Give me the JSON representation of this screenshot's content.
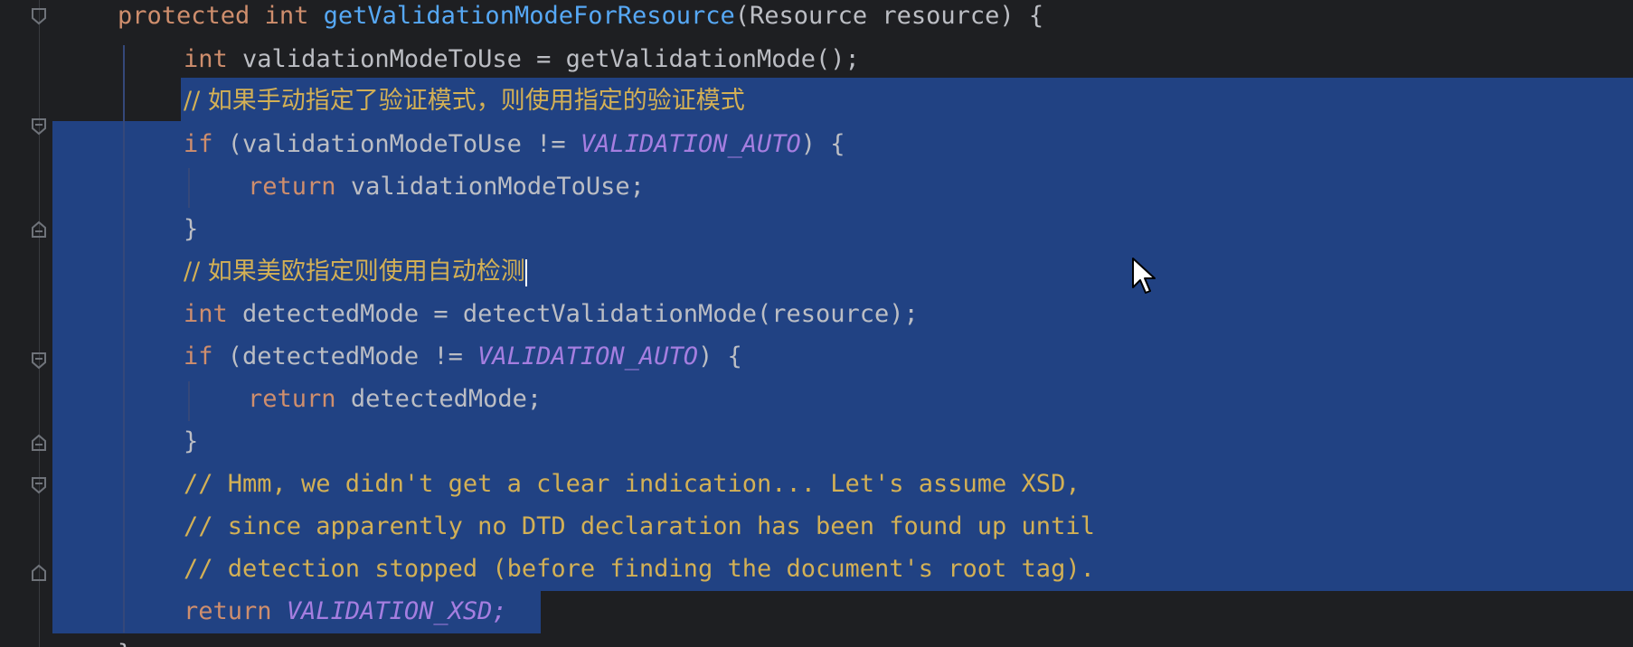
{
  "code": {
    "line1": {
      "kw1": "protected",
      "kw2": "int",
      "fn": "getValidationModeForResource",
      "rest": "(Resource resource) {"
    },
    "line2": {
      "kw": "int",
      "name": "validationModeToUse = ",
      "fn": "getValidationMode",
      "rest": "();"
    },
    "line3": {
      "comment": "// 如果手动指定了验证模式，则使用指定的验证模式"
    },
    "line4": {
      "kw": "if",
      "open": "(validationModeToUse != ",
      "const": "VALIDATION_AUTO",
      "close": ") {"
    },
    "line5": {
      "kw": "return",
      "rest": "validationModeToUse;"
    },
    "line6": {
      "brace": "}"
    },
    "line7": {
      "comment": "// 如果美欧指定则使用自动检测"
    },
    "line8": {
      "kw": "int",
      "name": "detectedMode = ",
      "fn": "detectValidationMode",
      "rest": "(resource);"
    },
    "line9": {
      "kw": "if",
      "open": "(detectedMode != ",
      "const": "VALIDATION_AUTO",
      "close": ") {"
    },
    "line10": {
      "kw": "return",
      "rest": "detectedMode;"
    },
    "line11": {
      "brace": "}"
    },
    "line12": {
      "comment": "// Hmm, we didn't get a clear indication... Let's assume XSD,"
    },
    "line13": {
      "comment": "// since apparently no DTD declaration has been found up until"
    },
    "line14": {
      "comment": "// detection stopped (before finding the document's root tag)."
    },
    "line15": {
      "kw": "return",
      "const": "VALIDATION_XSD;"
    },
    "line16": {
      "brace": "}"
    }
  },
  "colors": {
    "background": "#1e1f22",
    "selection": "#214283",
    "keyword": "#cf8e6d",
    "function": "#56a8f5",
    "comment": "#d3b055",
    "constant": "#a57ee0"
  },
  "icons": [
    "fold-marker-icon",
    "mouse-pointer-icon"
  ]
}
